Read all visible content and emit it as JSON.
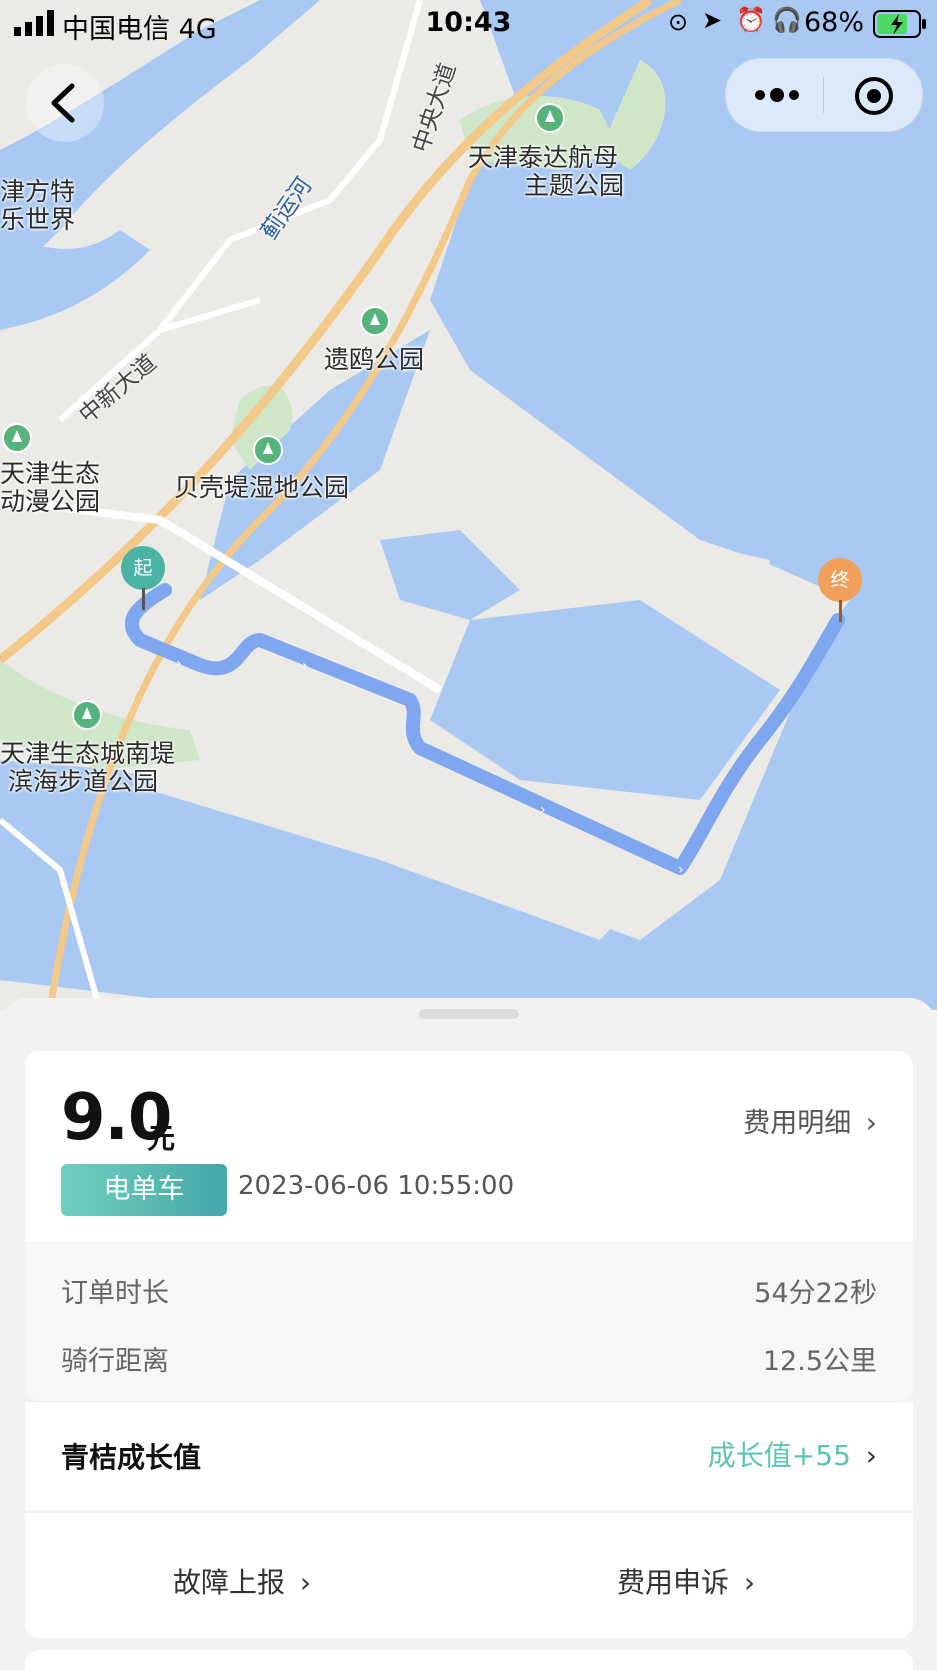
{
  "status_bar": {
    "carrier": "中国电信   4G",
    "time": "10:43",
    "battery": "68%"
  },
  "map": {
    "labels": [
      {
        "text": "天津泰达航母"
      },
      {
        "text": "主题公园"
      },
      {
        "text": "遗鸥公园"
      },
      {
        "text": "贝壳堤湿地公园"
      },
      {
        "text": "天津生态"
      },
      {
        "text": "动漫公园"
      },
      {
        "text": "天津生态城南堤"
      },
      {
        "text": "滨海步道公园"
      },
      {
        "text": "津方特"
      },
      {
        "text": "乐世界"
      }
    ],
    "roads": {
      "central_ave": "中央大道",
      "zhongxin_ave": "中新大道",
      "river": "蓟运河"
    },
    "start_marker": "起",
    "end_marker": "终"
  },
  "order": {
    "amount": "9.0",
    "unit": "元",
    "detail_link": "费用明细",
    "vehicle_tag": "电单车",
    "datetime": "2023-06-06 10:55:00",
    "duration_label": "订单时长",
    "duration_value": "54分22秒",
    "distance_label": "骑行距离",
    "distance_value": "12.5公里"
  },
  "growth": {
    "title": "青桔成长值",
    "value": "成长值+55"
  },
  "actions": {
    "report_fault": "故障上报",
    "fee_appeal": "费用申诉"
  },
  "colors": {
    "route": "#7fa7ef",
    "water": "#a9c9f3",
    "accent_teal": "#5ec4b3",
    "end_marker": "#f0a05a",
    "start_marker": "#4bb3a4"
  }
}
